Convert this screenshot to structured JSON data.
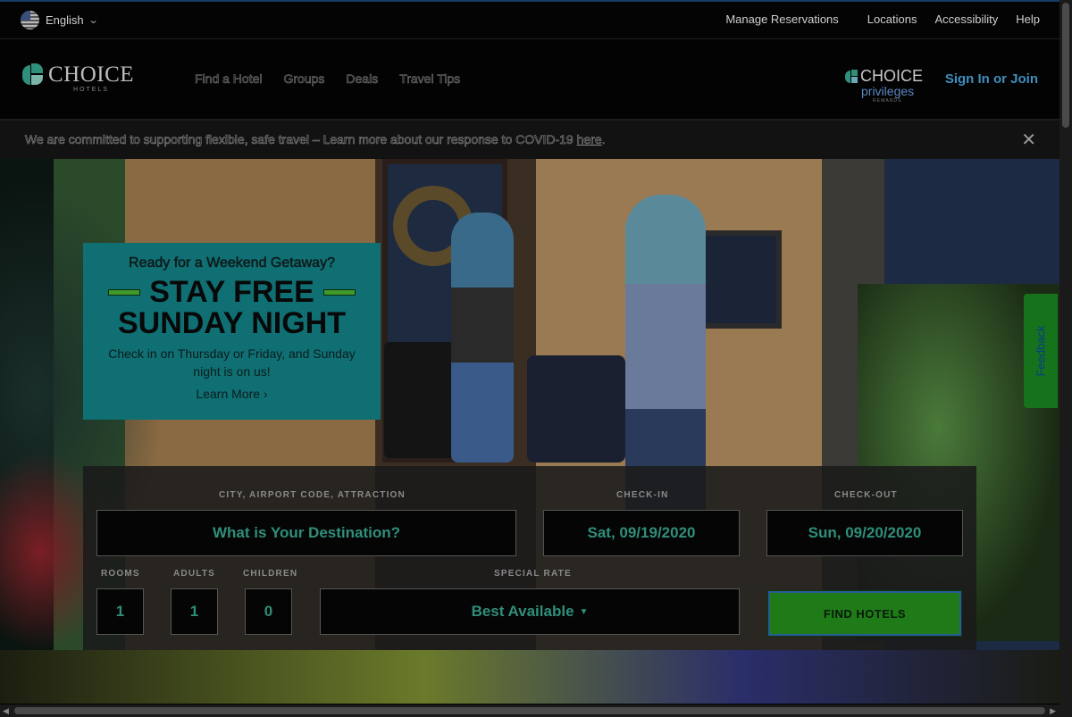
{
  "topbar": {
    "language": "English",
    "links": [
      "Manage Reservations",
      "Locations",
      "Accessibility",
      "Help"
    ]
  },
  "header": {
    "brand": "CHOICE",
    "brand_sub": "HOTELS",
    "nav": [
      "Find a Hotel",
      "Groups",
      "Deals",
      "Travel Tips"
    ],
    "rewards_brand": "CHOICE",
    "rewards_sub": "privileges",
    "rewards_tag": "REWARDS",
    "signin": "Sign In or Join"
  },
  "banner": {
    "text": "We are committed to supporting flexible, safe travel – Learn more about our response to COVID-19 ",
    "link": "here",
    "trail": "."
  },
  "promo": {
    "kicker": "Ready for a Weekend Getaway?",
    "line1": "STAY FREE",
    "line2": "SUNDAY NIGHT",
    "sub": "Check in on Thursday or Friday, and Sunday night is on us!",
    "cta": "Learn More ›"
  },
  "search": {
    "destination_label": "CITY, AIRPORT CODE, ATTRACTION",
    "destination_placeholder": "What is Your Destination?",
    "checkin_label": "CHECK-IN",
    "checkin_value": "Sat, 09/19/2020",
    "checkout_label": "CHECK-OUT",
    "checkout_value": "Sun, 09/20/2020",
    "rooms_label": "ROOMS",
    "rooms_value": "1",
    "adults_label": "ADULTS",
    "adults_value": "1",
    "children_label": "CHILDREN",
    "children_value": "0",
    "rate_label": "SPECIAL RATE",
    "rate_value": "Best Available",
    "find_button": "FIND HOTELS"
  },
  "feedback": "Feedback",
  "colors": {
    "accent": "#2f8f7a",
    "link": "#3f8fbf",
    "button": "#1f7a18",
    "promo_bg": "#0f6f73"
  }
}
